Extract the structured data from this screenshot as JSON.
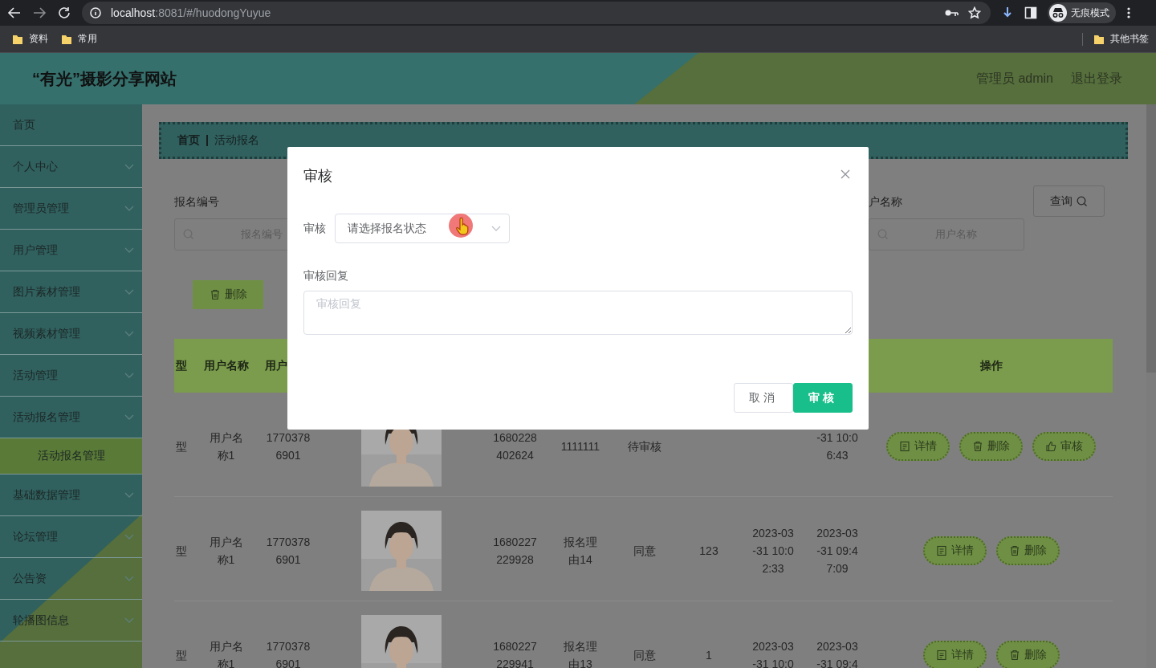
{
  "browser": {
    "url_host": "localhost",
    "url_rest": ":8081/#/huodongYuyue",
    "profile_label": "无痕模式",
    "bookmarks": [
      {
        "label": "资料"
      },
      {
        "label": "常用"
      }
    ],
    "other_bookmarks": "其他书签"
  },
  "header": {
    "title": "“有光”摄影分享网站",
    "user": "管理员 admin",
    "logout": "退出登录"
  },
  "sidebar": {
    "items": [
      {
        "label": "首页",
        "kind": "link"
      },
      {
        "label": "个人中心",
        "kind": "submenu"
      },
      {
        "label": "管理员管理",
        "kind": "submenu"
      },
      {
        "label": "用户管理",
        "kind": "submenu"
      },
      {
        "label": "图片素材管理",
        "kind": "submenu"
      },
      {
        "label": "视频素材管理",
        "kind": "submenu"
      },
      {
        "label": "活动管理",
        "kind": "submenu"
      },
      {
        "label": "活动报名管理",
        "kind": "submenu",
        "children": [
          {
            "label": "活动报名管理",
            "selected": true
          }
        ]
      },
      {
        "label": "基础数据管理",
        "kind": "submenu"
      },
      {
        "label": "论坛管理",
        "kind": "submenu"
      },
      {
        "label": "公告资",
        "kind": "submenu"
      },
      {
        "label": "轮播图信息",
        "kind": "submenu"
      }
    ]
  },
  "breadcrumb": [
    "首页",
    "活动报名"
  ],
  "search": {
    "fields": [
      {
        "label": "报名编号",
        "placeholder": "报名编号"
      },
      {
        "label": "户名称",
        "placeholder": "用户名称"
      }
    ],
    "button": "查询"
  },
  "toolbar": {
    "delete_button": "删除"
  },
  "table": {
    "columns": [
      "型",
      "用户名称",
      "用户",
      null,
      null,
      null,
      null,
      null,
      null,
      null,
      "操作"
    ],
    "rows": [
      {
        "cells": [
          "型",
          "用户名称1",
          "17703786901",
          {
            "kind": "picture"
          },
          "1680228402624",
          "1111111",
          "待审核",
          null,
          null,
          "-31 10:06:43"
        ],
        "actions": [
          {
            "label": "详情",
            "kind": "detail"
          },
          {
            "label": "删除",
            "kind": "delete"
          },
          {
            "label": "审核",
            "kind": "review"
          }
        ]
      },
      {
        "cells": [
          "型",
          "用户名称1",
          "17703786901",
          {
            "kind": "picture"
          },
          "1680227229928",
          "报名理由14",
          "同意",
          "123",
          "2023-03-31 10:02:33",
          "2023-03-31 09:47:09"
        ],
        "actions": [
          {
            "label": "详情",
            "kind": "detail"
          },
          {
            "label": "删除",
            "kind": "delete"
          }
        ]
      },
      {
        "cells": [
          "型",
          "用户名称1",
          "17703786901",
          {
            "kind": "picture"
          },
          "1680227229941",
          "报名理由13",
          "同意",
          "1",
          "2023-03-31 10:0",
          "2023-03-31 09:4"
        ],
        "actions": [
          {
            "label": "详情",
            "kind": "detail"
          },
          {
            "label": "删除",
            "kind": "delete"
          }
        ]
      }
    ]
  },
  "dialog": {
    "title": "审核",
    "status_label": "审核",
    "status_placeholder": "请选择报名状态",
    "reply_label": "审核回复",
    "reply_placeholder": "审核回复",
    "cancel": "取消",
    "confirm": "审核"
  }
}
